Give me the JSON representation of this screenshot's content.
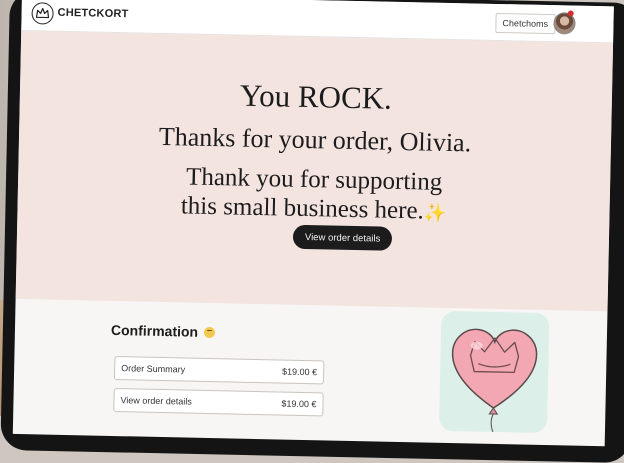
{
  "header": {
    "brand": "CHETCKORT",
    "check_button": "Chetchoms"
  },
  "hero": {
    "line1": "You ROCK.",
    "line2": "Thanks for your order, Olivia.",
    "line3a": "Thank you for supporting",
    "line3b": "this small business here.",
    "sparkle": "✨",
    "button": "View order details"
  },
  "confirmation": {
    "title": "Confirmation",
    "rows": [
      {
        "label": "Order Summary",
        "price": "$19.00 €"
      },
      {
        "label": "View order details",
        "price": "$19.00 €"
      }
    ]
  },
  "colors": {
    "hero_bg": "#f3e4e0",
    "button_bg": "#1c1c1c",
    "art_bg": "#dcefe9",
    "balloon": "#f2a7b3"
  }
}
